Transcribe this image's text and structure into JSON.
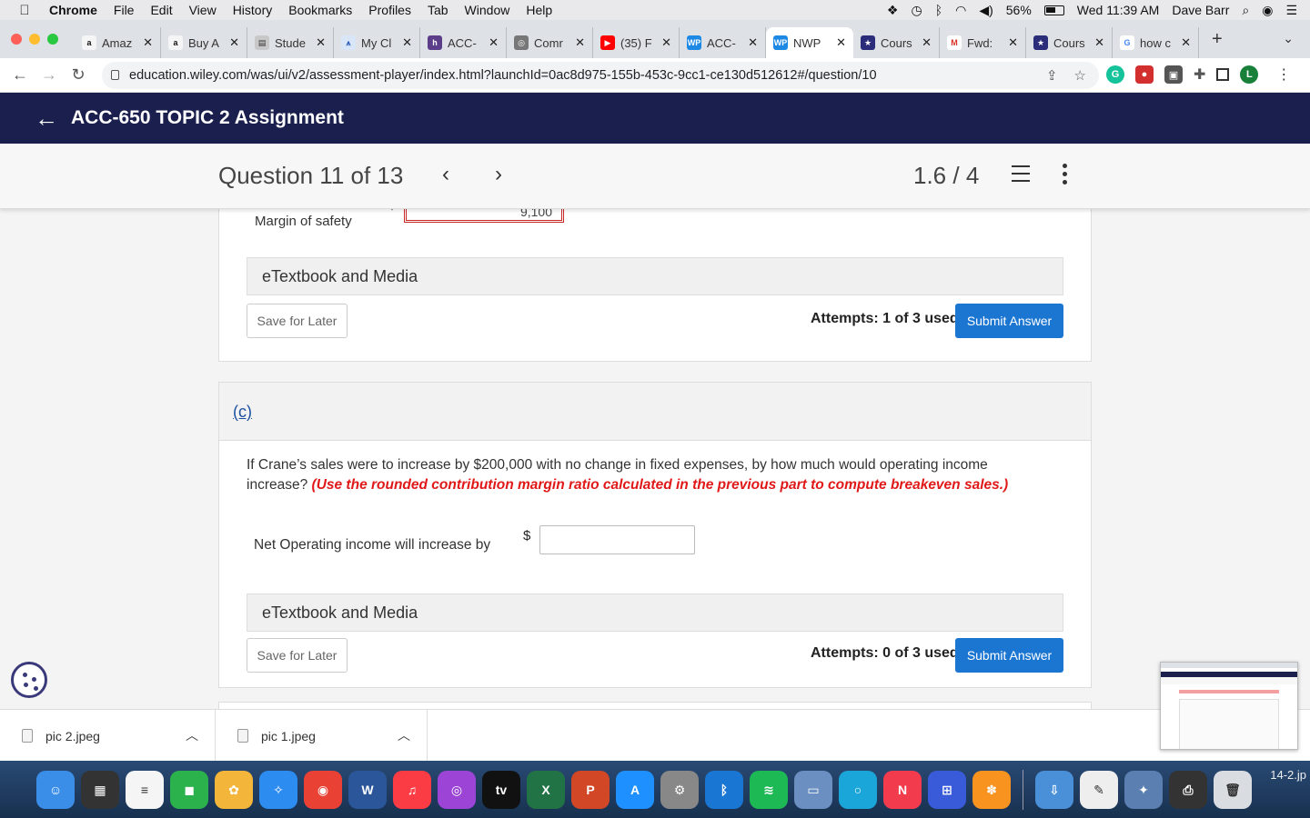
{
  "menubar": {
    "items": [
      "Chrome",
      "File",
      "Edit",
      "View",
      "History",
      "Bookmarks",
      "Profiles",
      "Tab",
      "Window",
      "Help"
    ],
    "battery": "56%",
    "clock": "Wed 11:39 AM",
    "user": "Dave Barr"
  },
  "tabs": [
    {
      "label": "Amaz",
      "fav": "a",
      "color": "#f5f5f5",
      "fg": "#111"
    },
    {
      "label": "Buy A",
      "fav": "a",
      "color": "#f5f5f5",
      "fg": "#111"
    },
    {
      "label": "Stude",
      "fav": "▤",
      "color": "#c8c8c8",
      "fg": "#333"
    },
    {
      "label": "My Cl",
      "fav": "⩚",
      "color": "#d9e6f7",
      "fg": "#2a5bb8"
    },
    {
      "label": "ACC-",
      "fav": "h",
      "color": "#5b3d8a",
      "fg": "#fff"
    },
    {
      "label": "Comr",
      "fav": "◎",
      "color": "#777",
      "fg": "#fff"
    },
    {
      "label": "(35) F",
      "fav": "▶",
      "color": "#ff0000",
      "fg": "#fff"
    },
    {
      "label": "ACC-",
      "fav": "WP",
      "color": "#1e88e5",
      "fg": "#fff"
    },
    {
      "label": "NWP",
      "fav": "WP",
      "color": "#1e88e5",
      "fg": "#fff",
      "active": true
    },
    {
      "label": "Cours",
      "fav": "★",
      "color": "#2b2d7a",
      "fg": "#fff"
    },
    {
      "label": "Fwd:",
      "fav": "M",
      "color": "#fff",
      "fg": "#d93025"
    },
    {
      "label": "Cours",
      "fav": "★",
      "color": "#2b2d7a",
      "fg": "#fff"
    },
    {
      "label": "how c",
      "fav": "G",
      "color": "#fff",
      "fg": "#4285f4"
    }
  ],
  "address": {
    "url": "education.wiley.com/was/ui/v2/assessment-player/index.html?launchId=0ac8d975-155b-453c-9cc1-ce130d512612#/question/10"
  },
  "app": {
    "title": "ACC-650 TOPIC 2 Assignment"
  },
  "question_nav": {
    "title": "Question 11 of 13",
    "score": "1.6 / 4"
  },
  "part_b": {
    "label": "Margin of safety",
    "currency": "$",
    "value": "9,100",
    "etextbook": "eTextbook and Media",
    "save_label": "Save for Later",
    "attempts": "Attempts: 1 of 3 used",
    "submit_label": "Submit Answer"
  },
  "part_c": {
    "label": "(c)",
    "question": "If Crane’s sales were to increase by $200,000 with no change in fixed expenses, by how much would operating income increase?",
    "instruction": "(Use the rounded contribution margin ratio calculated in the previous part to compute breakeven sales.)",
    "answer_label": "Net Operating income will increase by",
    "currency": "$",
    "answer_value": "",
    "etextbook": "eTextbook and Media",
    "save_label": "Save for Later",
    "attempts": "Attempts: 0 of 3 used",
    "submit_label": "Submit Answer"
  },
  "downloads": [
    {
      "name": "pic 2.jpeg"
    },
    {
      "name": "pic 1.jpeg"
    }
  ],
  "dock": {
    "edge_text": "14-2.jp",
    "icons": [
      {
        "name": "finder-icon",
        "color": "#3b8ee8",
        "glyph": "☺"
      },
      {
        "name": "activity-monitor-icon",
        "color": "#333",
        "glyph": "▦"
      },
      {
        "name": "reminders-icon",
        "color": "#f5f5f5",
        "glyph": "≡"
      },
      {
        "name": "facetime-icon",
        "color": "#2bb24c",
        "glyph": "◼"
      },
      {
        "name": "photos-icon",
        "color": "#f3b63a",
        "glyph": "✿"
      },
      {
        "name": "safari-icon",
        "color": "#2d8cf0",
        "glyph": "✧"
      },
      {
        "name": "chrome-icon",
        "color": "#e94235",
        "glyph": "◉"
      },
      {
        "name": "word-icon",
        "color": "#2b579a",
        "glyph": "W"
      },
      {
        "name": "music-icon",
        "color": "#fc3c44",
        "glyph": "♫"
      },
      {
        "name": "podcasts-icon",
        "color": "#9b44d6",
        "glyph": "◎"
      },
      {
        "name": "apple-tv-icon",
        "color": "#111",
        "glyph": "tv"
      },
      {
        "name": "excel-icon",
        "color": "#217346",
        "glyph": "X"
      },
      {
        "name": "powerpoint-icon",
        "color": "#d24726",
        "glyph": "P"
      },
      {
        "name": "app-store-icon",
        "color": "#1e90ff",
        "glyph": "A"
      },
      {
        "name": "system-preferences-icon",
        "color": "#888",
        "glyph": "⚙"
      },
      {
        "name": "bluetooth-icon",
        "color": "#1976d2",
        "glyph": "ᛒ"
      },
      {
        "name": "spotify-icon",
        "color": "#1db954",
        "glyph": "≋"
      },
      {
        "name": "preview-icon",
        "color": "#6a8fc0",
        "glyph": "▭"
      },
      {
        "name": "screen-recorder-icon",
        "color": "#1aa6d9",
        "glyph": "○"
      },
      {
        "name": "news-icon",
        "color": "#f23c4e",
        "glyph": "N"
      },
      {
        "name": "keynote-icon",
        "color": "#3a5bd9",
        "glyph": "⊞"
      },
      {
        "name": "flower-app-icon",
        "color": "#f7931e",
        "glyph": "✽"
      },
      {
        "name": "downloads-folder-icon",
        "color": "#4a90d9",
        "glyph": "⇩"
      },
      {
        "name": "textedit-icon",
        "color": "#eee",
        "glyph": "✎"
      },
      {
        "name": "photo-slideshow-icon",
        "color": "#5a7fb0",
        "glyph": "✦"
      },
      {
        "name": "printer-icon",
        "color": "#333",
        "glyph": "⎙"
      },
      {
        "name": "trash-icon",
        "color": "#d9dde2",
        "glyph": "🗑"
      }
    ]
  }
}
